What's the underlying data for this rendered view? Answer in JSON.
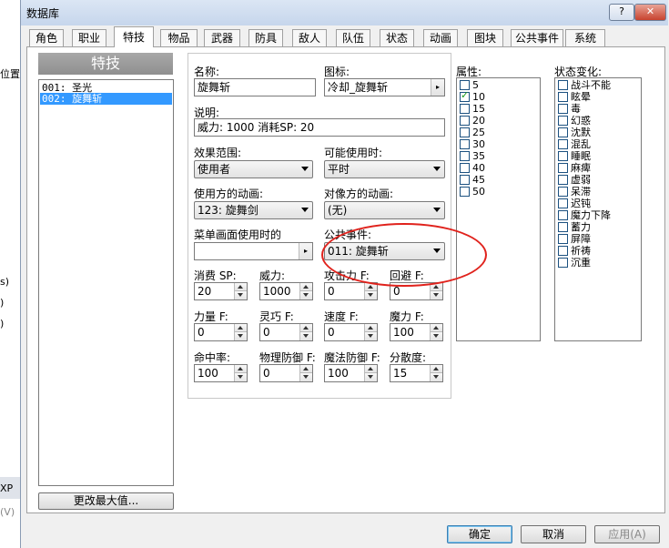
{
  "background": {
    "fragments": [
      "位置",
      "s)",
      ")",
      ")",
      "XP",
      "(V)"
    ]
  },
  "window": {
    "title": "数据库",
    "help_label": "?",
    "close_label": "✕"
  },
  "tabs": [
    "角色",
    "职业",
    "特技",
    "物品",
    "武器",
    "防具",
    "敌人",
    "队伍",
    "状态",
    "动画",
    "图块",
    "公共事件",
    "系统"
  ],
  "active_tab": "特技",
  "list": {
    "header": "特技",
    "items": [
      "001: 圣光",
      "002: 旋舞斩"
    ],
    "selected_index": 1,
    "max_button": "更改最大值..."
  },
  "form": {
    "name_label": "名称:",
    "name_value": "旋舞斩",
    "icon_label": "图标:",
    "icon_value": "冷却_旋舞斩",
    "desc_label": "说明:",
    "desc_value": "威力: 1000  消耗SP: 20",
    "scope_label": "效果范围:",
    "scope_value": "使用者",
    "occasion_label": "可能使用时:",
    "occasion_value": "平时",
    "user_anim_label": "使用方的动画:",
    "user_anim_value": "123: 旋舞剑",
    "target_anim_label": "对像方的动画:",
    "target_anim_value": "(无)",
    "menu_se_label": "菜单画面使用时的",
    "common_event_label": "公共事件:",
    "common_event_value": "011: 旋舞斩",
    "sp_cost_label": "消费 SP:",
    "sp_cost_value": "20",
    "power_label": "威力:",
    "power_value": "1000",
    "atk_f_label": "攻击力 F:",
    "atk_f_value": "0",
    "eva_f_label": "回避 F:",
    "eva_f_value": "0",
    "str_f_label": "力量 F:",
    "str_f_value": "0",
    "dex_f_label": "灵巧 F:",
    "dex_f_value": "0",
    "agi_f_label": "速度 F:",
    "agi_f_value": "0",
    "int_f_label": "魔力 F:",
    "int_f_value": "100",
    "hit_label": "命中率:",
    "hit_value": "100",
    "pdef_f_label": "物理防御 F:",
    "pdef_f_value": "0",
    "mdef_f_label": "魔法防御 F:",
    "mdef_f_value": "100",
    "variance_label": "分散度:",
    "variance_value": "15",
    "picker_arrow": "▸"
  },
  "attributes": {
    "label": "属性:",
    "items": [
      {
        "name": "5",
        "checked": false
      },
      {
        "name": "10",
        "checked": true
      },
      {
        "name": "15",
        "checked": false
      },
      {
        "name": "20",
        "checked": false
      },
      {
        "name": "25",
        "checked": false
      },
      {
        "name": "30",
        "checked": false
      },
      {
        "name": "35",
        "checked": false
      },
      {
        "name": "40",
        "checked": false
      },
      {
        "name": "45",
        "checked": false
      },
      {
        "name": "50",
        "checked": false
      }
    ]
  },
  "states": {
    "label": "状态变化:",
    "items": [
      "战斗不能",
      "眩晕",
      "毒",
      "幻惑",
      "沈默",
      "混乱",
      "睡眠",
      "麻痺",
      "虚弱",
      "呆滞",
      "迟钝",
      "魔力下降",
      "蓄力",
      "屏障",
      "祈祷",
      "沉重"
    ]
  },
  "footer": {
    "ok": "确定",
    "cancel": "取消",
    "apply": "应用(A)"
  },
  "colors": {
    "selection": "#3399ff",
    "annotation": "#e0221c",
    "check": "#1a9c1a"
  }
}
